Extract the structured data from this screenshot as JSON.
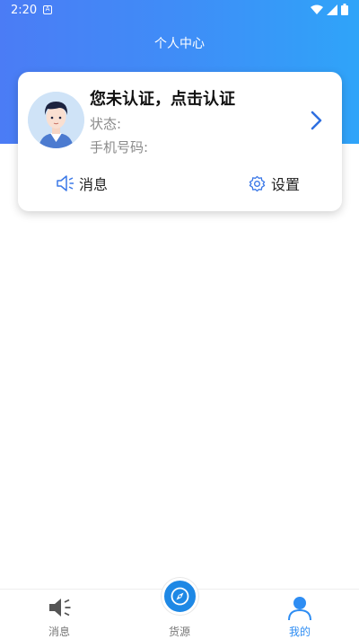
{
  "status_bar": {
    "time": "2:20",
    "a_badge": "A"
  },
  "header": {
    "title": "个人中心"
  },
  "profile_card": {
    "auth_title": "您未认证，点击认证",
    "status_label": "状态:",
    "phone_label": "手机号码:",
    "message_label": "消息",
    "settings_label": "设置"
  },
  "tabbar": {
    "tabs": [
      {
        "label": "消息"
      },
      {
        "label": "货源"
      },
      {
        "label": "我的"
      }
    ],
    "active_color": "#2e8df3"
  },
  "colors": {
    "header_start": "#4b7cf5",
    "header_end": "#2fa4f9",
    "accent": "#1e88e5"
  }
}
